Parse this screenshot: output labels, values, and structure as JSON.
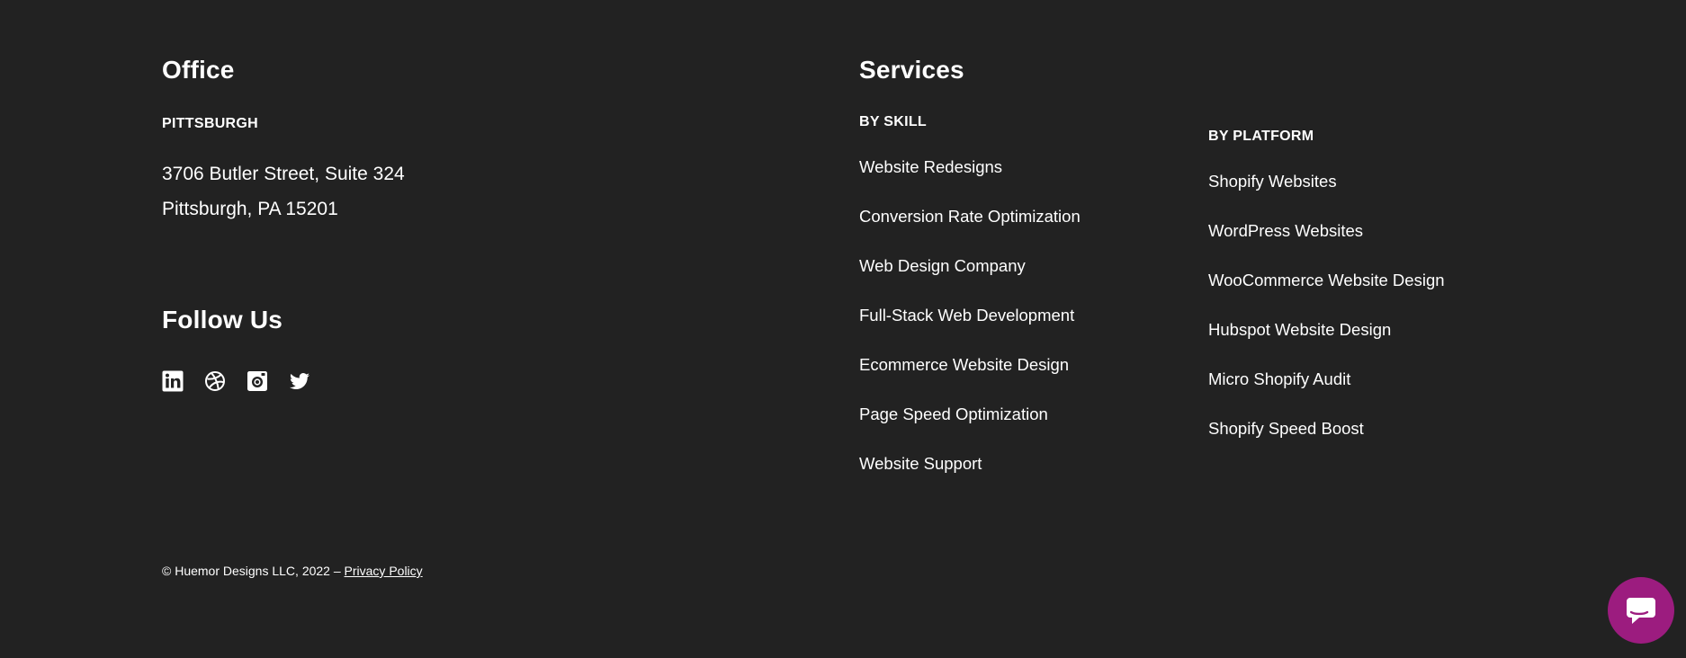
{
  "office": {
    "title": "Office",
    "city": "PITTSBURGH",
    "address_line1": "3706 Butler Street, Suite 324",
    "address_line2": "Pittsburgh, PA 15201"
  },
  "follow": {
    "title": "Follow Us",
    "icons": [
      "linkedin-icon",
      "dribbble-icon",
      "instagram-icon",
      "twitter-icon"
    ]
  },
  "services": {
    "title": "Services",
    "by_skill": {
      "label": "BY SKILL",
      "items": [
        "Website Redesigns",
        "Conversion Rate Optimization",
        "Web Design Company",
        "Full-Stack Web Development",
        "Ecommerce Website Design",
        "Page Speed Optimization",
        "Website Support"
      ]
    },
    "by_platform": {
      "label": "BY PLATFORM",
      "items": [
        "Shopify Websites",
        "WordPress Websites",
        "WooCommerce Website Design",
        "Hubspot Website Design",
        "Micro Shopify Audit",
        "Shopify Speed Boost"
      ]
    }
  },
  "footer": {
    "copyright": "© Huemor Designs LLC, 2022 –",
    "privacy_link": "Privacy Policy"
  },
  "chat": {
    "icon": "chat-bubble-icon"
  },
  "colors": {
    "background": "#222222",
    "text": "#ffffff",
    "chat_accent": "#9c1c7f"
  }
}
